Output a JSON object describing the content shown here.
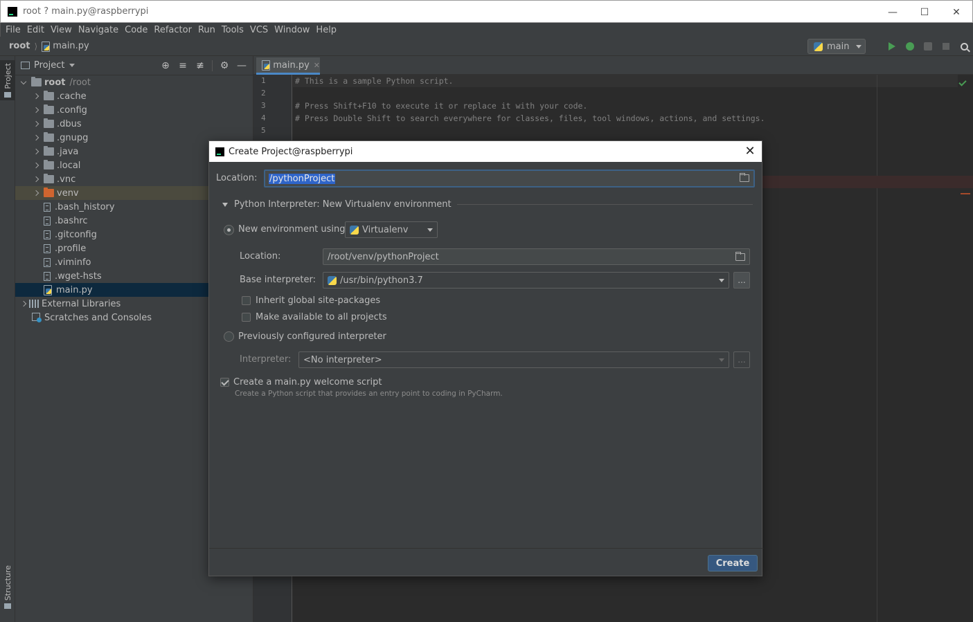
{
  "window": {
    "title": "root ? main.py@raspberrypi",
    "controls": [
      "minimize",
      "maximize",
      "close"
    ]
  },
  "menu": [
    "File",
    "Edit",
    "View",
    "Navigate",
    "Code",
    "Refactor",
    "Run",
    "Tools",
    "VCS",
    "Window",
    "Help"
  ],
  "navbar": {
    "root": "root",
    "file": "main.py",
    "run_config": "main"
  },
  "tool_strip": {
    "project_tab": "Project",
    "structure_tab": "Structure"
  },
  "project_panel": {
    "title": "Project",
    "root_name": "root",
    "root_path": "/root",
    "folders": [
      ".cache",
      ".config",
      ".dbus",
      ".gnupg",
      ".java",
      ".local",
      ".vnc",
      "venv"
    ],
    "files": [
      ".bash_history",
      ".bashrc",
      ".gitconfig",
      ".profile",
      ".viminfo",
      ".wget-hsts",
      "main.py"
    ],
    "external_libraries": "External Libraries",
    "scratches": "Scratches and Consoles"
  },
  "editor": {
    "tab": "main.py",
    "line_numbers": [
      "1",
      "2",
      "3",
      "4",
      "5"
    ],
    "lines": [
      "# This is a sample Python script.",
      "",
      "# Press Shift+F10 to execute it or replace it with your code.",
      "# Press Double Shift to search everywhere for classes, files, tool windows, actions, and settings.",
      ""
    ]
  },
  "dialog": {
    "title": "Create Project@raspberrypi",
    "location_label": "Location:",
    "location_value": "/pythonProject",
    "interpreter_section": "Python Interpreter: New Virtualenv environment",
    "new_env_label": "New environment using",
    "env_tool": "Virtualenv",
    "env_location_label": "Location:",
    "env_location_value": "/root/venv/pythonProject",
    "base_interpreter_label": "Base interpreter:",
    "base_interpreter_value": "/usr/bin/python3.7",
    "inherit_label": "Inherit global site-packages",
    "make_available_label": "Make available to all projects",
    "previous_label": "Previously configured interpreter",
    "interpreter_label": "Interpreter:",
    "interpreter_value": "<No interpreter>",
    "welcome_label": "Create a main.py welcome script",
    "welcome_hint": "Create a Python script that provides an entry point to coding in PyCharm.",
    "browse_label": "...",
    "create_button": "Create"
  }
}
